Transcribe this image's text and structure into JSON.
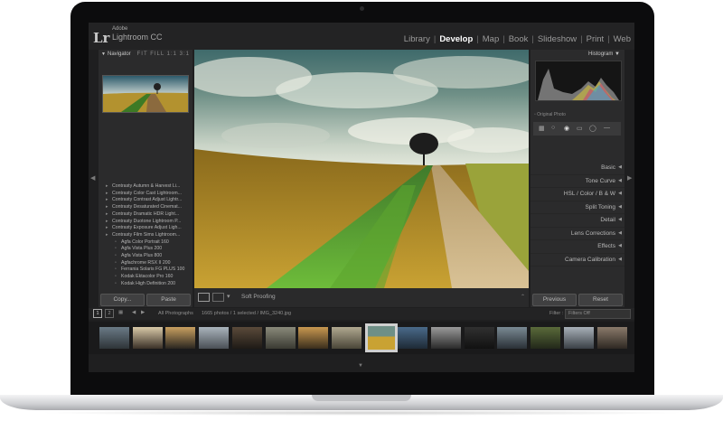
{
  "app": {
    "logo": "Lr",
    "vendor": "Adobe",
    "product": "Lightroom CC"
  },
  "modules": {
    "library": "Library",
    "develop": "Develop",
    "map": "Map",
    "book": "Book",
    "slideshow": "Slideshow",
    "print": "Print",
    "web": "Web",
    "separator": "|",
    "active": "develop"
  },
  "left_panel": {
    "navigator_title": "Navigator",
    "fit_options": "FIT  FILL  1:1  3:1",
    "presets": [
      {
        "label": "Contrasty Autumn & Harvest Li...",
        "sub": false
      },
      {
        "label": "Contrasty Color Cast Lightroom...",
        "sub": false
      },
      {
        "label": "Contrasty Contrast Adjust Lightr...",
        "sub": false
      },
      {
        "label": "Contrasty Desaturated Cinemat...",
        "sub": false
      },
      {
        "label": "Contrasty Dramatic HDR Light...",
        "sub": false
      },
      {
        "label": "Contrasty Duotone Lightroom P...",
        "sub": false
      },
      {
        "label": "Contrasty Exposure Adjust Ligh...",
        "sub": false
      },
      {
        "label": "Contrasty Film Sims Lightroom...",
        "sub": false
      },
      {
        "label": "Agfa Color Portrait 160",
        "sub": true
      },
      {
        "label": "Agfa Vista Plus 200",
        "sub": true
      },
      {
        "label": "Agfa Vista Plus 800",
        "sub": true
      },
      {
        "label": "Agfachrome RSX II 200",
        "sub": true
      },
      {
        "label": "Ferrania Solaris FG PLUS 100",
        "sub": true
      },
      {
        "label": "Kodak Ektacolor Pro 160",
        "sub": true
      },
      {
        "label": "Kodak High Definition 200",
        "sub": true
      }
    ],
    "copy_label": "Copy...",
    "paste_label": "Paste"
  },
  "toolbar": {
    "soft_proofing": "Soft Proofing"
  },
  "right_panel": {
    "histogram_title": "Histogram",
    "original_photo": "Original Photo",
    "sections": [
      "Basic",
      "Tone Curve",
      "HSL  /  Color  /  B & W",
      "Split Toning",
      "Detail",
      "Lens Corrections",
      "Effects",
      "Camera Calibration"
    ],
    "previous_label": "Previous",
    "reset_label": "Reset"
  },
  "filmstrip": {
    "pages": [
      "1",
      "2"
    ],
    "source": "All Photographs",
    "status": "1665 photos / 1 selected / IMG_3240.jpg",
    "filter_label": "Filter :",
    "filter_value": "Filters Off",
    "thumb_count": 16,
    "selected_index": 8
  }
}
